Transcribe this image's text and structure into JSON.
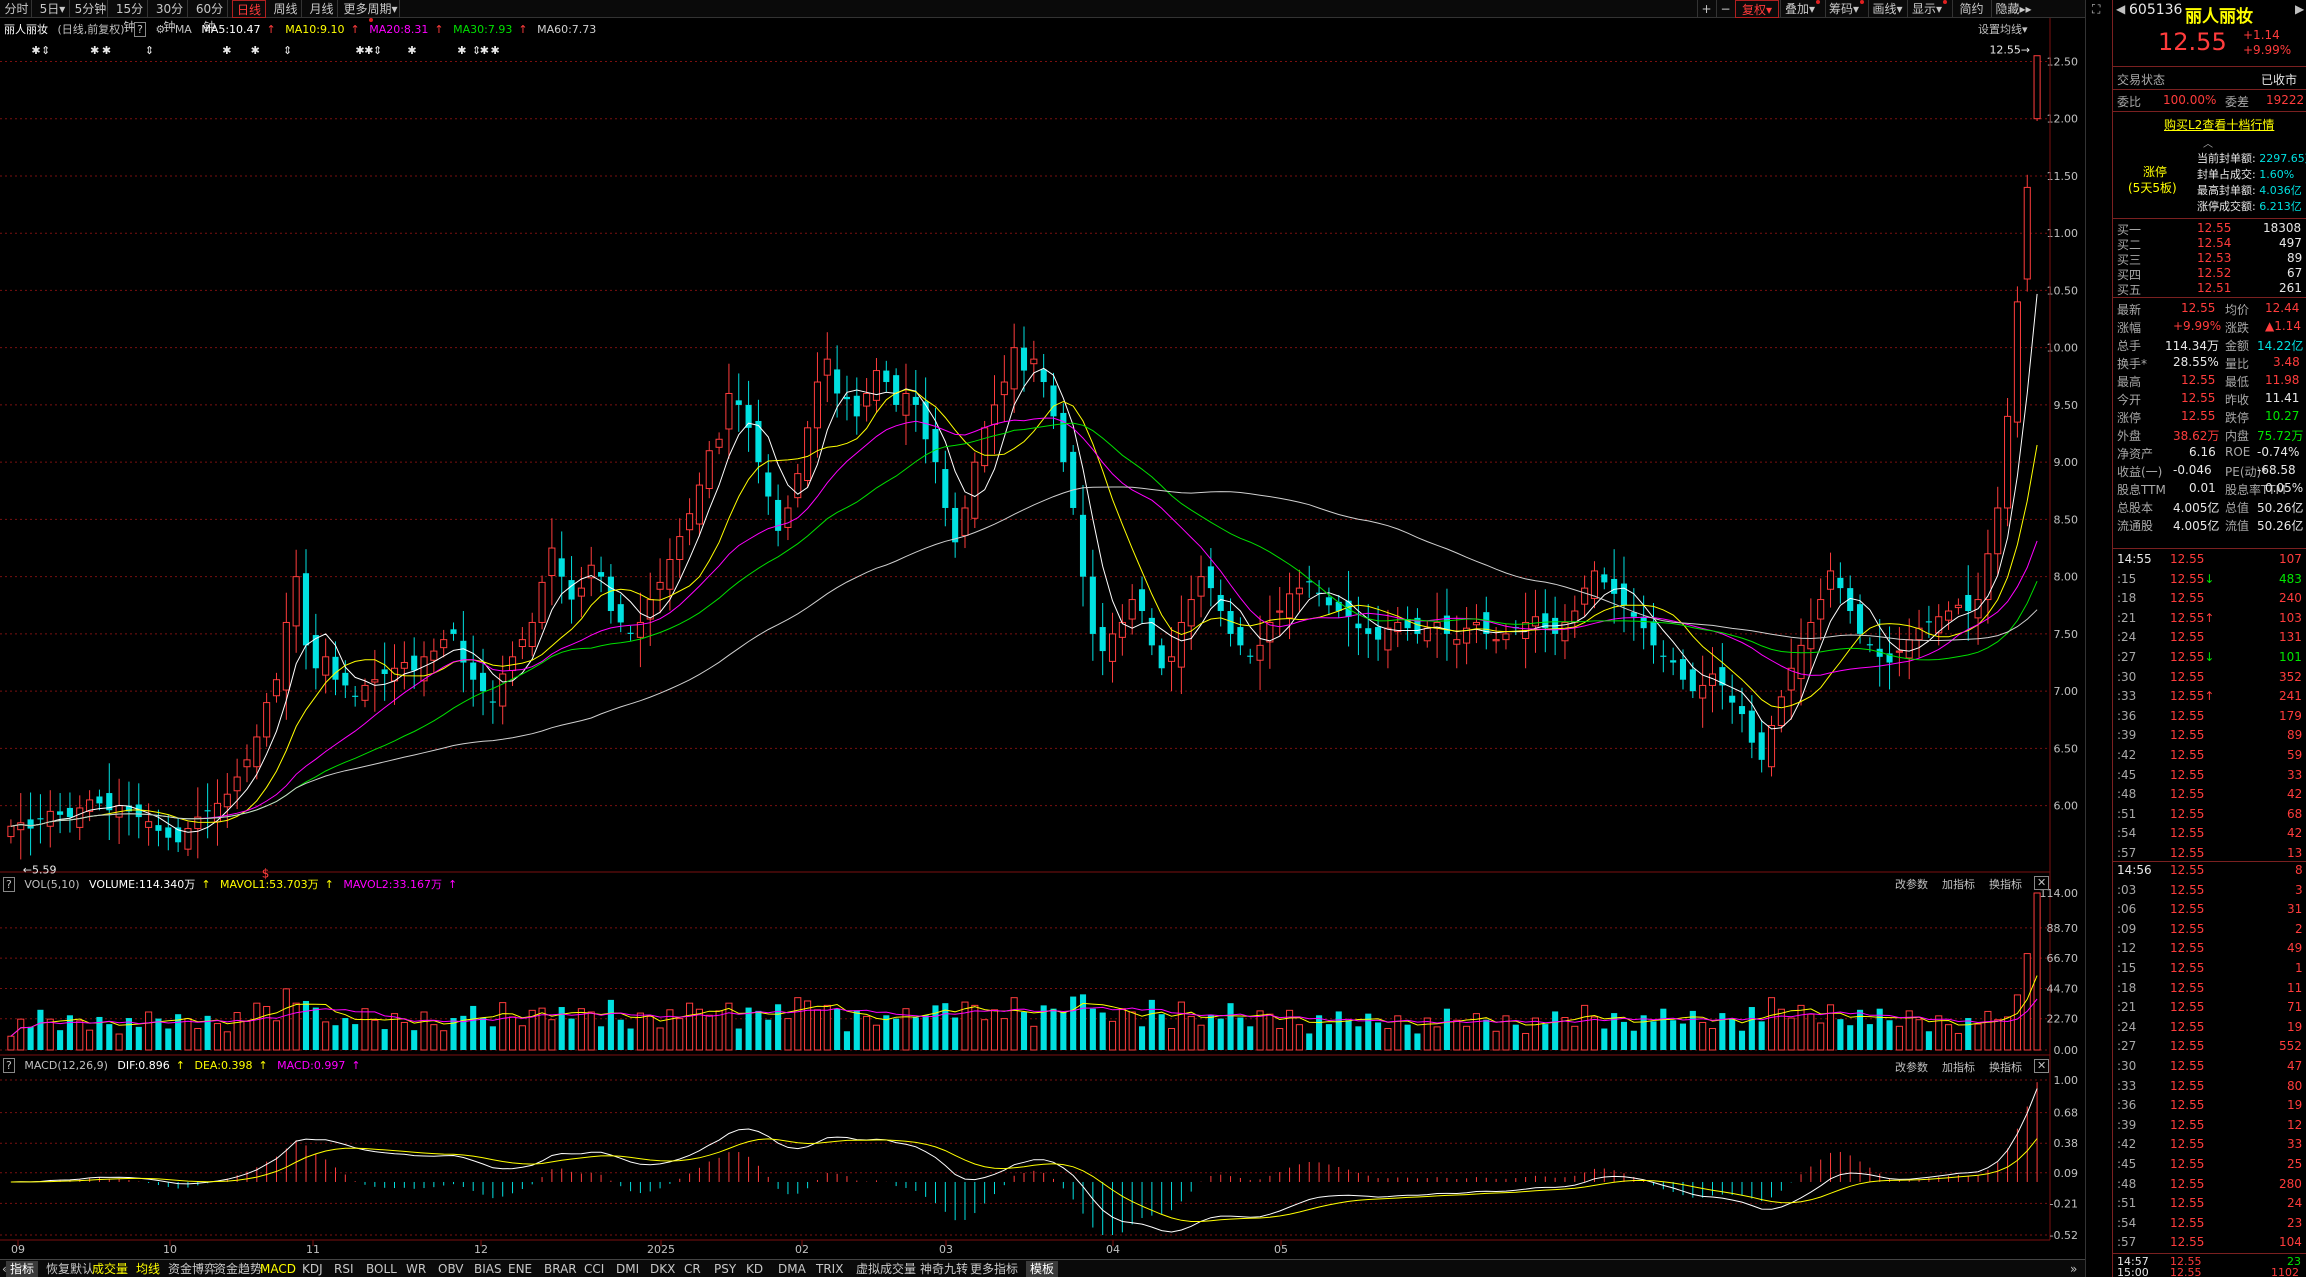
{
  "top_periods": [
    {
      "label": "分时"
    },
    {
      "label": "5日",
      "arrow": "▾"
    },
    {
      "label": "5分钟"
    },
    {
      "label": "15分钟"
    },
    {
      "label": "30分钟"
    },
    {
      "label": "60分钟"
    },
    {
      "label": "日线",
      "active": true
    },
    {
      "label": "周线"
    },
    {
      "label": "月线"
    },
    {
      "label": "更多周期",
      "arrow": "▾"
    }
  ],
  "top_tools": [
    {
      "label": "+"
    },
    {
      "label": "−"
    },
    {
      "label": "复权",
      "active": true
    },
    {
      "label": "叠加"
    },
    {
      "label": "筹码"
    },
    {
      "label": "画线"
    },
    {
      "label": "显示"
    },
    {
      "label": "简约"
    },
    {
      "label": "隐藏"
    }
  ],
  "legend": {
    "name": "丽人丽妆",
    "mode": "(日线,前复权)",
    "help": "?",
    "ma_label": "MA",
    "ma5": "MA5:10.47",
    "ma10": "MA10:9.10",
    "ma20": "MA20:8.31",
    "ma30": "MA30:7.93",
    "ma60": "MA60:7.73",
    "settings": "设置均线"
  },
  "colors": {
    "up": "#ff3c3c",
    "down": "#00e0e0",
    "ma5": "#ffffff",
    "ma10": "#ffff00",
    "ma20": "#ff00ff",
    "ma30": "#00e000",
    "ma60": "#d0d0d0",
    "grid": "#7a1010"
  },
  "vol_header": {
    "title": "VOL(5,10)",
    "volume": "VOLUME:114.340万",
    "mavol1": "MAVOL1:53.703万",
    "mavol2": "MAVOL2:33.167万"
  },
  "macd_header": {
    "title": "MACD(12,26,9)",
    "dif": "DIF:0.896",
    "dea": "DEA:0.398",
    "macd": "MACD:0.997"
  },
  "panel_buttons": {
    "change": "改参数",
    "add": "加指标",
    "swap": "换指标"
  },
  "bottom_tabs": [
    {
      "label": "指标",
      "boxed": true
    },
    {
      "label": "恢复默认"
    },
    {
      "label": "成交量",
      "hl": true
    },
    {
      "label": "均线",
      "hl": true
    },
    {
      "label": "资金博弈"
    },
    {
      "label": "资金趋势"
    },
    {
      "label": "MACD",
      "hl": true
    },
    {
      "label": "KDJ"
    },
    {
      "label": "RSI"
    },
    {
      "label": "BOLL"
    },
    {
      "label": "WR"
    },
    {
      "label": "OBV"
    },
    {
      "label": "BIAS"
    },
    {
      "label": "ENE"
    },
    {
      "label": "BRAR"
    },
    {
      "label": "CCI"
    },
    {
      "label": "DMI"
    },
    {
      "label": "DKX"
    },
    {
      "label": "CR"
    },
    {
      "label": "PSY"
    },
    {
      "label": "KD"
    },
    {
      "label": "DMA"
    },
    {
      "label": "TRIX"
    },
    {
      "label": "虚拟成交量"
    },
    {
      "label": "神奇九转"
    },
    {
      "label": "更多指标"
    },
    {
      "label": "模板",
      "boxed": true
    }
  ],
  "chart_data": {
    "type": "candlestick",
    "x_ticks": [
      "09",
      "10",
      "11",
      "12",
      "2025",
      "02",
      "03",
      "04",
      "05"
    ],
    "price_ticks": [
      "12.50",
      "12.00",
      "11.50",
      "11.00",
      "10.50",
      "10.00",
      "9.50",
      "9.00",
      "8.50",
      "8.00",
      "7.50",
      "7.00",
      "6.50",
      "6.00"
    ],
    "price_range": [
      5.7,
      12.6
    ],
    "low_marker": "5.59",
    "high_marker": "12.55",
    "event_marker": "$",
    "volume_ticks": [
      "114.00",
      "88.70",
      "66.70",
      "44.70",
      "22.70",
      "0.00"
    ],
    "macd_ticks": [
      "1.00",
      "0.68",
      "0.38",
      "0.09",
      "-0.21",
      "-0.52"
    ],
    "close": [
      5.82,
      5.85,
      5.8,
      5.88,
      5.95,
      5.92,
      5.9,
      5.98,
      6.05,
      6.02,
      5.96,
      6.0,
      5.95,
      5.9,
      5.86,
      5.78,
      5.72,
      5.68,
      5.8,
      5.9,
      5.95,
      6.02,
      6.1,
      6.25,
      6.4,
      6.6,
      6.9,
      7.1,
      7.6,
      8.0,
      7.4,
      7.2,
      7.3,
      7.1,
      7.05,
      6.95,
      7.05,
      7.1,
      7.15,
      7.2,
      7.25,
      7.18,
      7.3,
      7.35,
      7.45,
      7.5,
      7.25,
      7.1,
      7.0,
      6.9,
      7.15,
      7.3,
      7.45,
      7.6,
      7.95,
      8.25,
      8.0,
      7.8,
      7.9,
      8.1,
      8.0,
      7.7,
      7.6,
      7.5,
      7.6,
      7.8,
      7.95,
      8.15,
      8.35,
      8.55,
      8.8,
      9.1,
      9.2,
      9.6,
      9.5,
      9.3,
      9.0,
      8.7,
      8.4,
      8.6,
      8.9,
      9.3,
      9.7,
      9.9,
      9.6,
      9.55,
      9.4,
      9.6,
      9.8,
      9.7,
      9.5,
      9.6,
      9.5,
      9.2,
      9.0,
      8.6,
      8.3,
      8.6,
      9.0,
      9.3,
      9.5,
      9.7,
      10.0,
      9.8,
      9.9,
      9.7,
      9.4,
      9.0,
      8.6,
      8.0,
      7.5,
      7.35,
      7.5,
      7.6,
      7.8,
      7.7,
      7.4,
      7.2,
      7.3,
      7.6,
      7.8,
      8.0,
      7.9,
      7.7,
      7.5,
      7.4,
      7.3,
      7.4,
      7.6,
      7.7,
      7.85,
      7.9,
      7.95,
      7.85,
      7.75,
      7.7,
      7.65,
      7.55,
      7.5,
      7.45,
      7.55,
      7.6,
      7.55,
      7.5,
      7.55,
      7.6,
      7.5,
      7.45,
      7.55,
      7.6,
      7.5,
      7.45,
      7.5,
      7.55,
      7.6,
      7.65,
      7.55,
      7.5,
      7.6,
      7.7,
      7.9,
      8.05,
      7.95,
      7.85,
      7.75,
      7.65,
      7.55,
      7.4,
      7.3,
      7.25,
      7.1,
      7.0,
      7.05,
      7.15,
      7.05,
      6.9,
      6.8,
      6.55,
      6.4,
      6.7,
      6.95,
      7.2,
      7.4,
      7.6,
      7.8,
      8.05,
      7.9,
      7.7,
      7.5,
      7.4,
      7.3,
      7.25,
      7.35,
      7.45,
      7.55,
      7.6,
      7.65,
      7.7,
      7.75,
      7.7,
      7.8,
      8.2,
      8.6,
      9.4,
      10.4,
      11.4,
      12.55
    ]
  }
}
